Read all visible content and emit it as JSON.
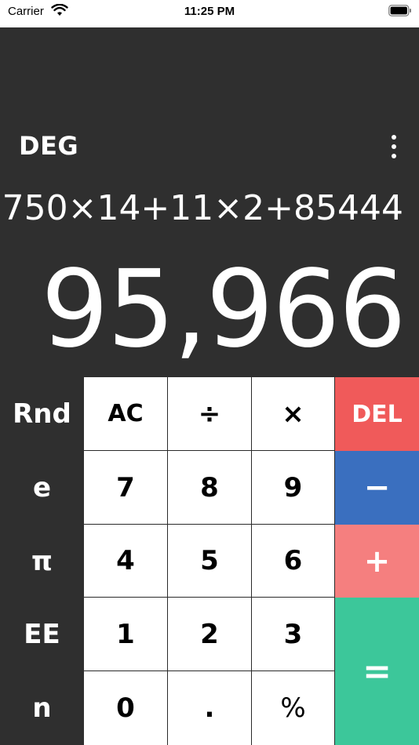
{
  "status_bar": {
    "carrier": "Carrier",
    "time": "11:25 PM"
  },
  "display": {
    "mode": "DEG",
    "expression": "750×14+11×2+85444",
    "result": "95,966"
  },
  "keypad": {
    "scientific": [
      "Rnd",
      "e",
      "π",
      "EE",
      "n"
    ],
    "rows": [
      [
        "AC",
        "÷",
        "×"
      ],
      [
        "7",
        "8",
        "9"
      ],
      [
        "4",
        "5",
        "6"
      ],
      [
        "1",
        "2",
        "3"
      ],
      [
        "0",
        ".",
        "%"
      ]
    ],
    "operators": {
      "delete": "DEL",
      "minus": "−",
      "plus": "+",
      "equals": "="
    }
  },
  "colors": {
    "background": "#2f2f2f",
    "delete": "#f05a5a",
    "minus": "#3a6fbf",
    "plus": "#f57f7f",
    "equals": "#3cc79a"
  }
}
